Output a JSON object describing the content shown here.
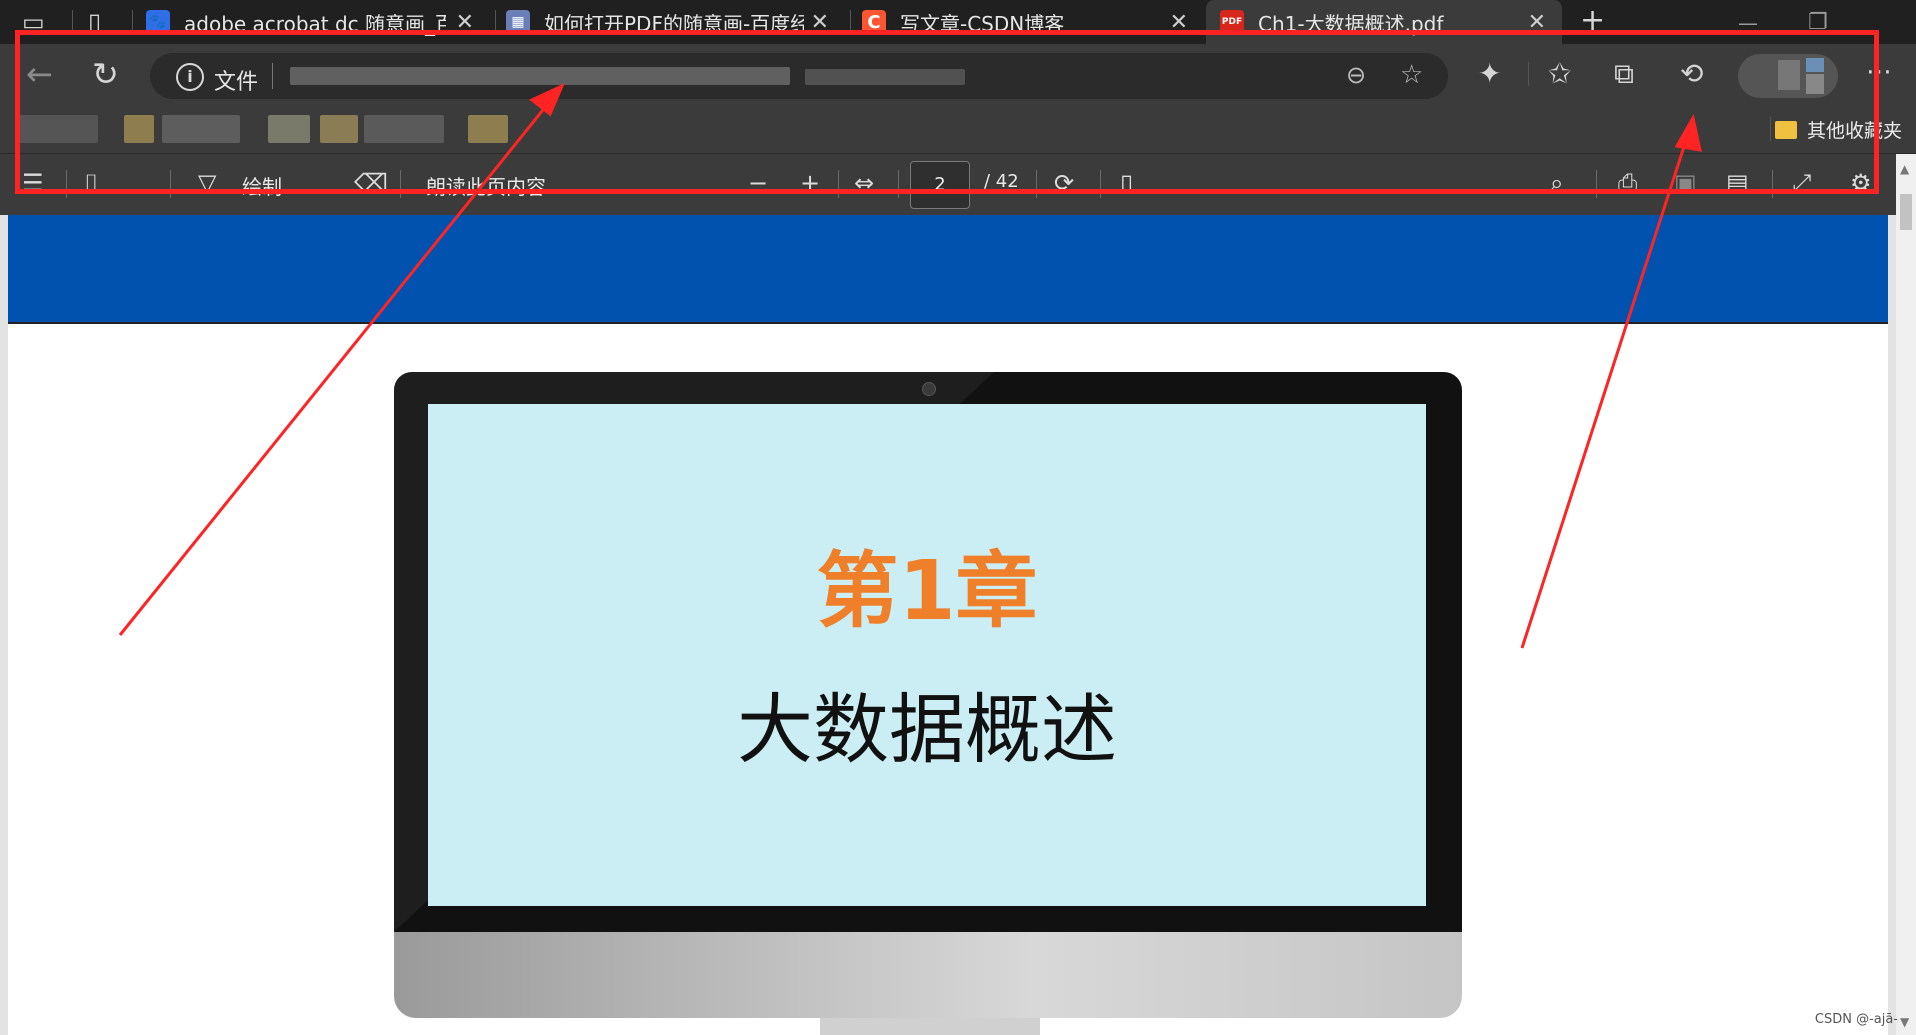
{
  "tabs": [
    {
      "title": "adobe acrobat dc 随意画_百度搜",
      "favicon_color": "#2f6ee6",
      "favicon_glyph": "🐾"
    },
    {
      "title": "如何打开PDF的随意画-百度经验",
      "favicon_color": "#6a7fb8",
      "favicon_glyph": "▦"
    },
    {
      "title": "写文章-CSDN博客",
      "favicon_color": "#fc5531",
      "favicon_glyph": "C"
    },
    {
      "title": "Ch1-大数据概述.pdf",
      "favicon_color": "#d9261c",
      "favicon_glyph": "PDF",
      "active": true
    }
  ],
  "window": {
    "new_tab_glyph": "+",
    "minimize_glyph": "—",
    "restore_glyph": "❐"
  },
  "address_bar": {
    "scheme_label": "文件"
  },
  "bookmarks": {
    "other_label": "其他收藏夹"
  },
  "pdf_toolbar": {
    "draw_label": "绘制",
    "read_aloud_label": "朗读此页内容",
    "current_page": "2",
    "total_pages": "/ 42"
  },
  "document": {
    "chapter": "第1章",
    "title": "大数据概述",
    "colors": {
      "banner": "#0052ae",
      "screen": "#cbeef4",
      "chapter": "#f07f2a"
    }
  },
  "annotation": {
    "color": "#ff2424"
  },
  "watermark": "CSDN @-ajā-"
}
